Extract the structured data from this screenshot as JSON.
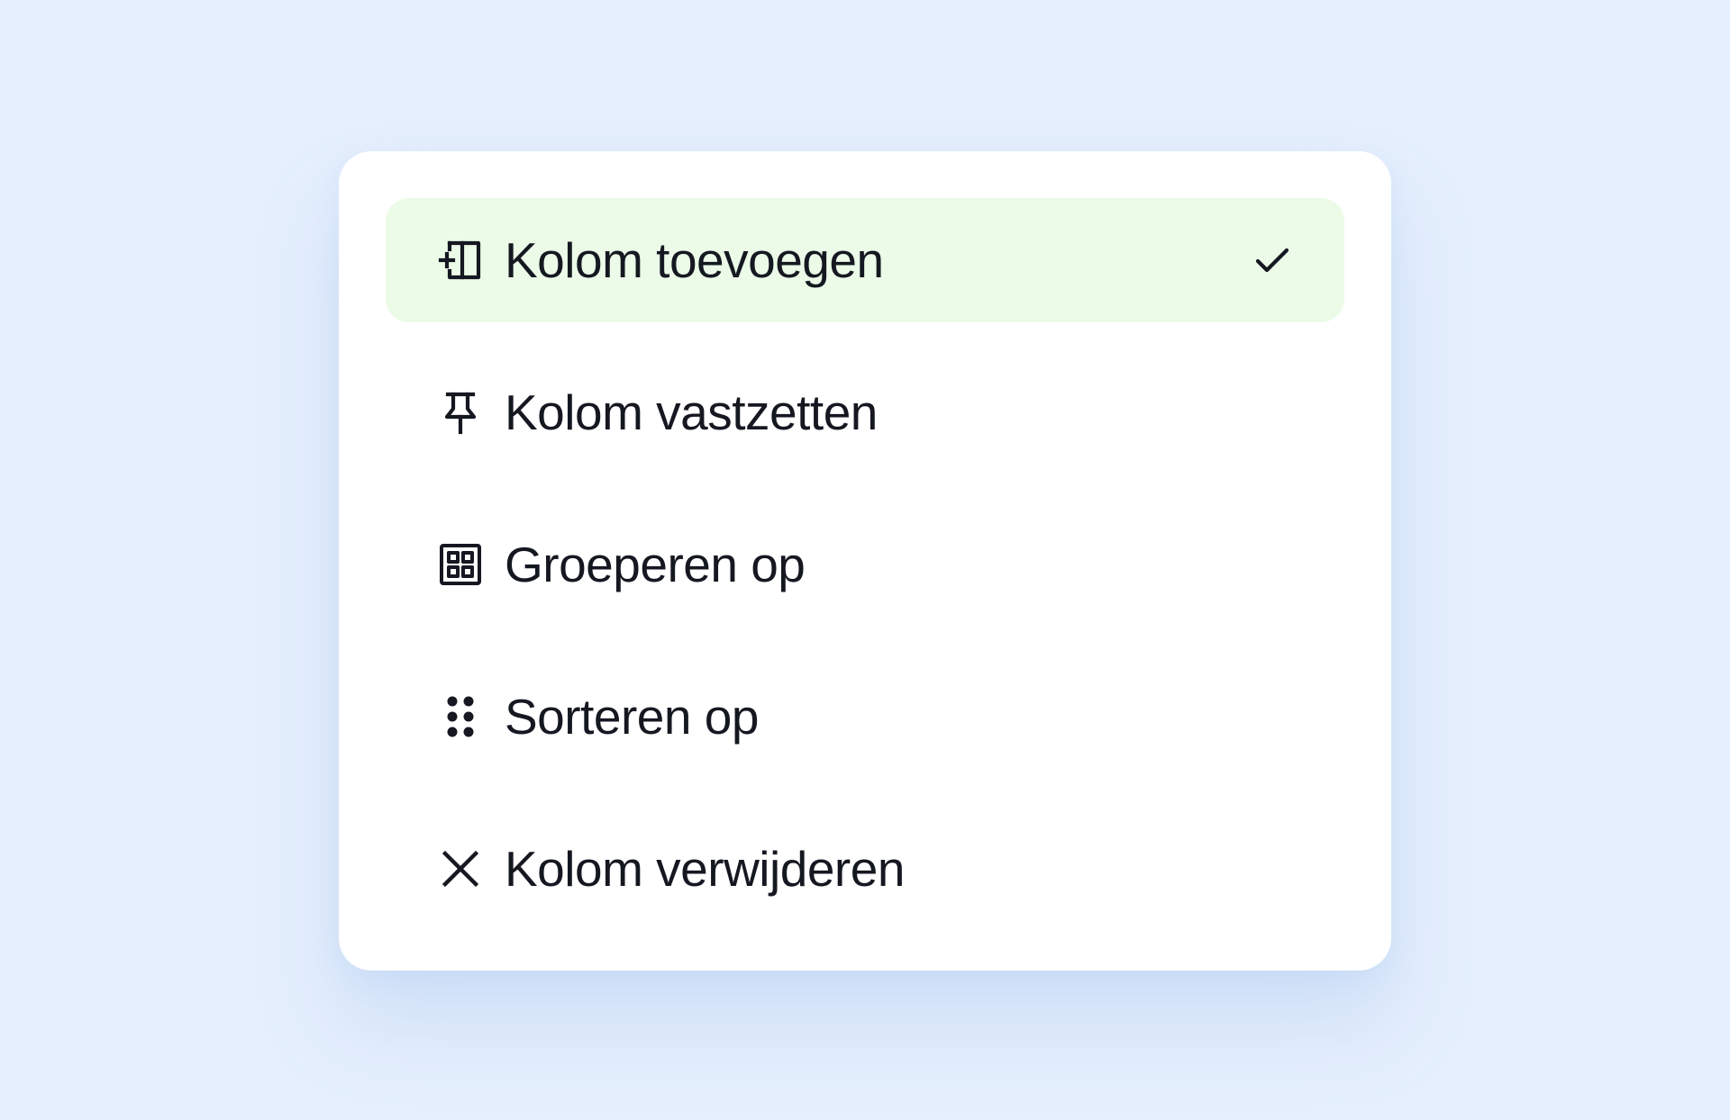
{
  "colors": {
    "background": "#e5effd",
    "card": "#ffffff",
    "active_item": "#ebfbe7",
    "text": "#151821"
  },
  "menu": {
    "items": [
      {
        "label": "Kolom toevoegen",
        "icon": "add-column-icon",
        "selected": true
      },
      {
        "label": "Kolom vastzetten",
        "icon": "pin-icon",
        "selected": false
      },
      {
        "label": "Groeperen op",
        "icon": "group-grid-icon",
        "selected": false
      },
      {
        "label": "Sorteren op",
        "icon": "drag-dots-icon",
        "selected": false
      },
      {
        "label": "Kolom verwijderen",
        "icon": "close-icon",
        "selected": false
      }
    ],
    "selected_indicator_icon": "checkmark-icon"
  }
}
